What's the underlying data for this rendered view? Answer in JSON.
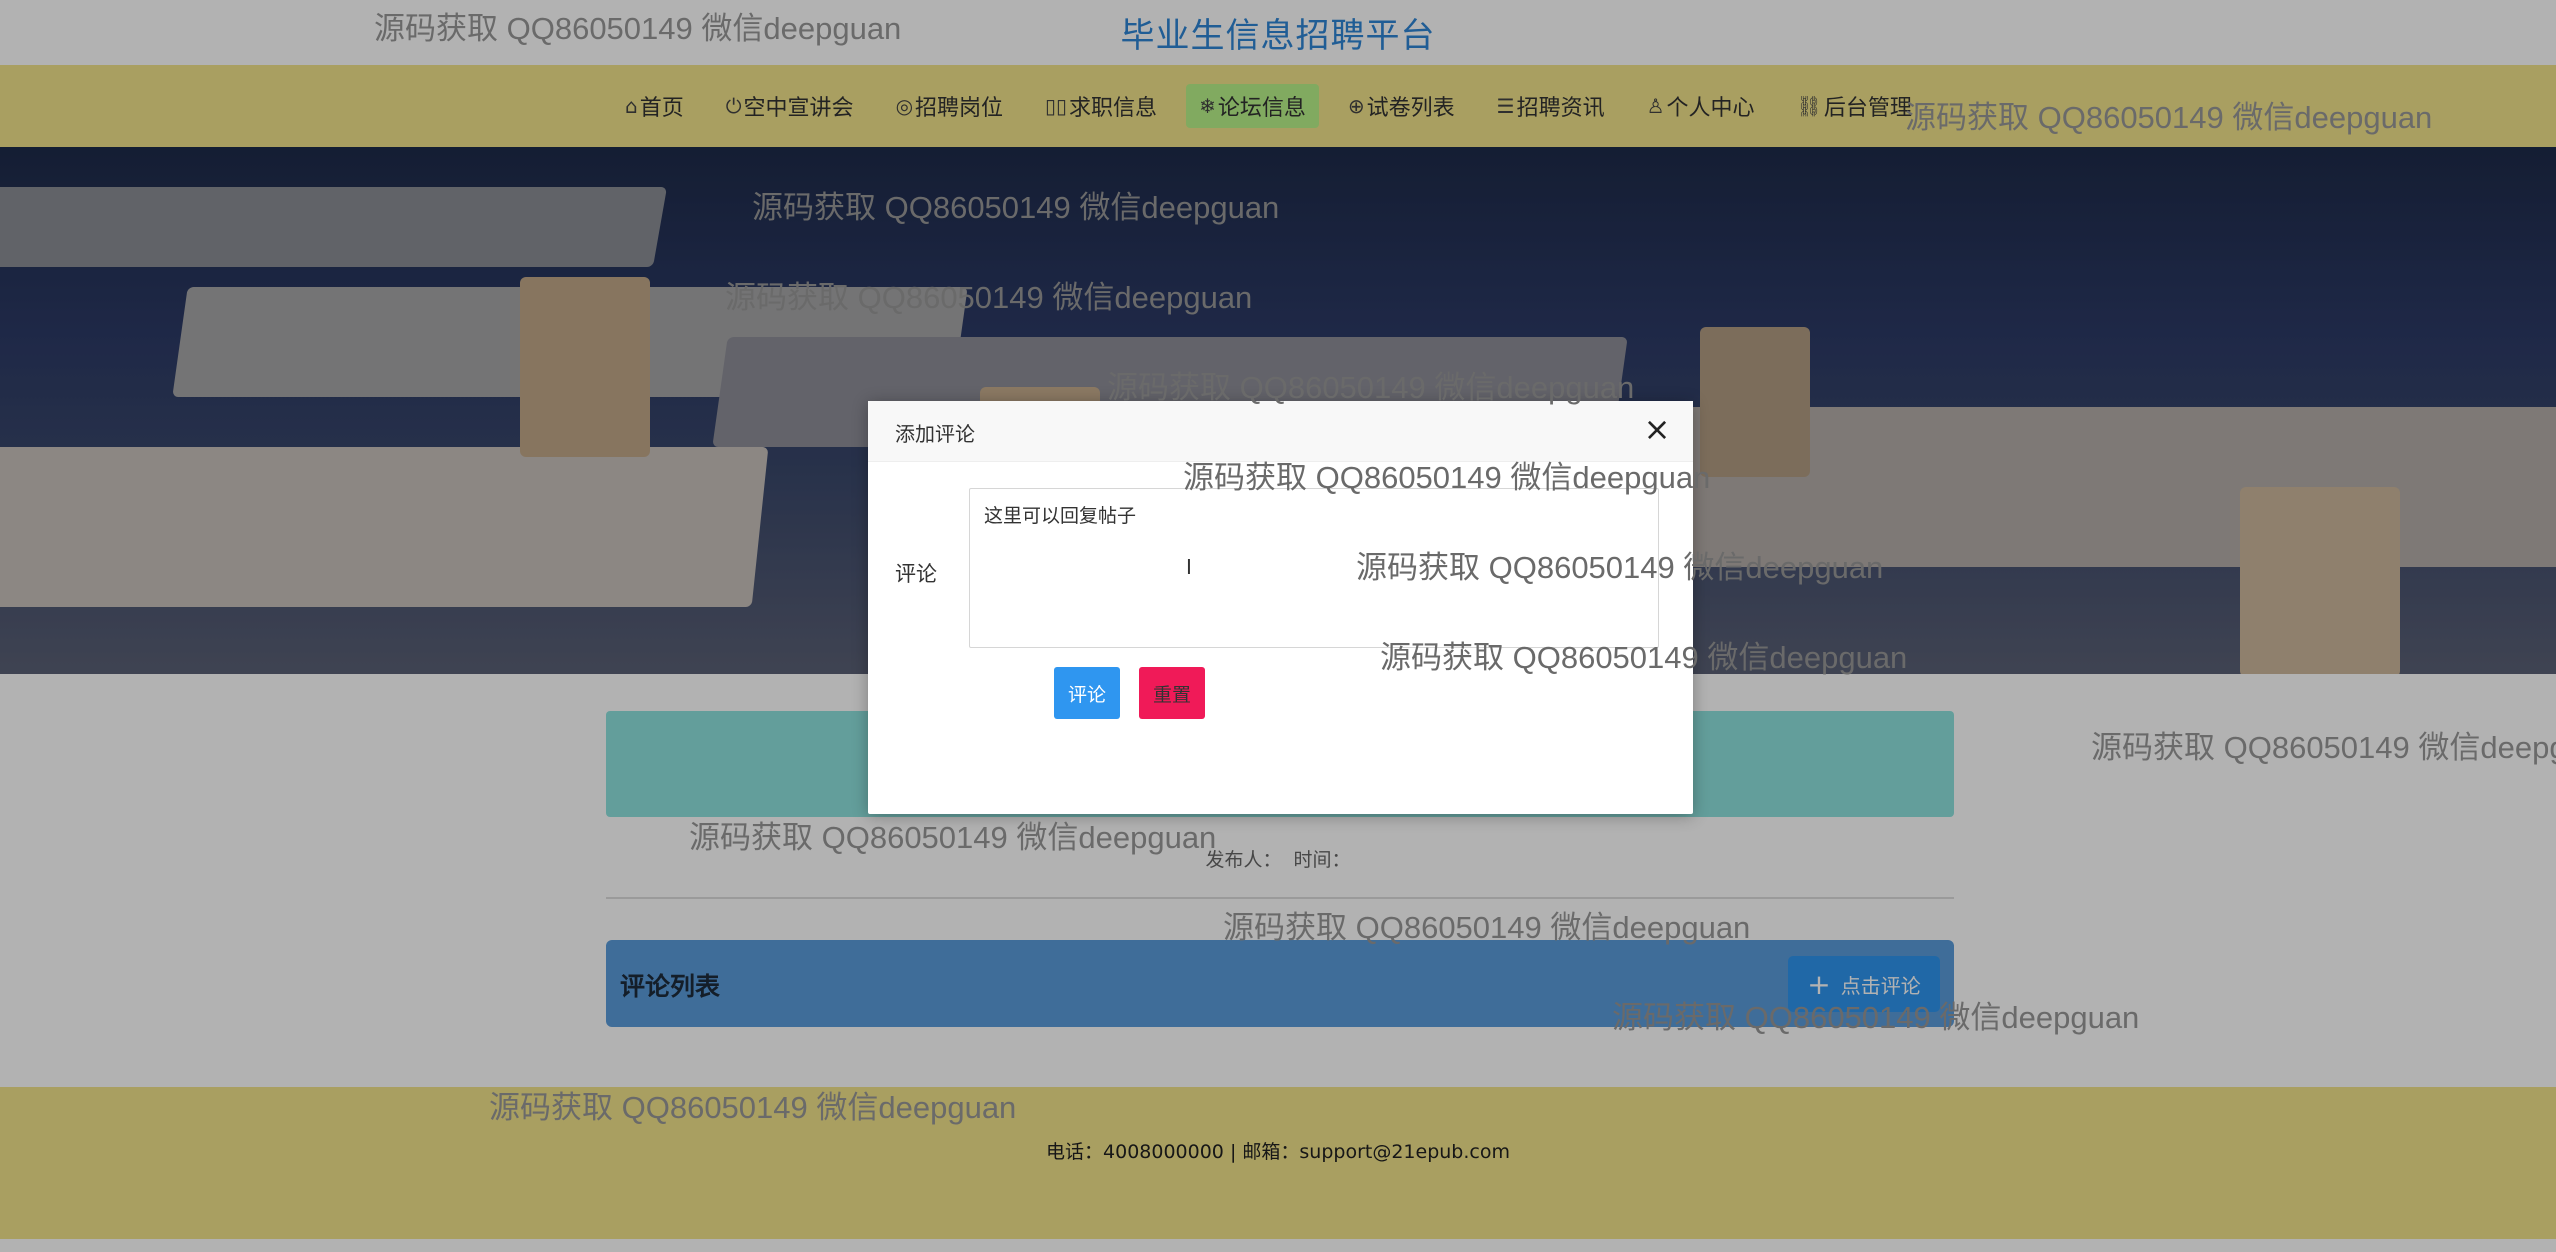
{
  "header": {
    "site_title": "毕业生信息招聘平台"
  },
  "nav": {
    "items": [
      {
        "label": "首页",
        "icon": "home-icon"
      },
      {
        "label": "空中宣讲会",
        "icon": "power-icon"
      },
      {
        "label": "招聘岗位",
        "icon": "palette-icon"
      },
      {
        "label": "求职信息",
        "icon": "columns-icon"
      },
      {
        "label": "论坛信息",
        "icon": "snowflake-icon",
        "active": true
      },
      {
        "label": "试卷列表",
        "icon": "globe-icon"
      },
      {
        "label": "招聘资讯",
        "icon": "sliders-icon"
      },
      {
        "label": "个人中心",
        "icon": "user-icon"
      },
      {
        "label": "后台管理",
        "icon": "link-icon"
      }
    ]
  },
  "post": {
    "publisher_label": "发布人：",
    "time_label": "时间："
  },
  "comments": {
    "title": "评论列表",
    "add_button": "点击评论"
  },
  "modal": {
    "title": "添加评论",
    "comment_label": "评论",
    "comment_value": "这里可以回复帖子",
    "submit": "评论",
    "reset": "重置"
  },
  "footer": {
    "text": "电话：4008000000 | 邮箱：support@21epub.com"
  },
  "watermark": {
    "text": "源码获取 QQ86050149 微信deepguan"
  },
  "colors": {
    "nav_bg": "#f3e48c",
    "nav_active": "#b9f48a",
    "title_band": "#8fe3df",
    "comments_bar": "#5b9ddb",
    "primary": "#2f96f0",
    "danger": "#f01a58"
  }
}
